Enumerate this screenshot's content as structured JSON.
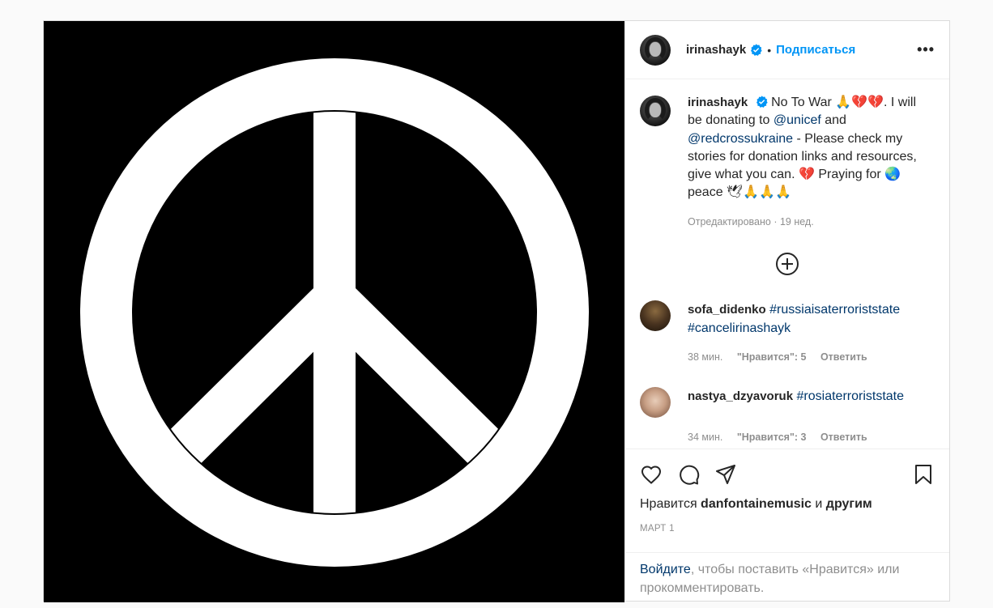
{
  "header": {
    "username": "irinashayk",
    "separator": "•",
    "follow_label": "Подписаться",
    "more_label": "•••"
  },
  "caption": {
    "username": "irinashayk",
    "text1": "No To War 🙏💔💔. I will be donating to ",
    "mention1": "@unicef",
    "text2": " and ",
    "mention2": "@redcrossukraine",
    "text3": " - Please check my stories for donation links and resources, give what you can. 💔 Praying for 🌏peace 🕊🙏🙏🙏",
    "meta": "Отредактировано · 19 нед."
  },
  "comments": [
    {
      "username": "sofa_didenko",
      "text": "#russiaisaterroriststate #cancelirinashayk",
      "time": "38 мин.",
      "likes": "\"Нравится\": 5",
      "reply": "Ответить"
    },
    {
      "username": "nastya_dzyavoruk",
      "text": "#rosiaterroriststate",
      "time": "34 мин.",
      "likes": "\"Нравится\": 3",
      "reply": "Ответить"
    }
  ],
  "likes": {
    "prefix": "Нравится ",
    "user": "danfontainemusic",
    "middle": " и ",
    "others": "другим"
  },
  "date": "МАРТ 1",
  "login": {
    "link": "Войдите",
    "rest": ", чтобы поставить «Нравится» или прокомментировать."
  },
  "colors": {
    "accent": "#0095f6",
    "link": "#00376b",
    "muted": "#8e8e8e",
    "text": "#262626"
  },
  "icons": [
    "verified-icon",
    "more-icon",
    "load-more-icon",
    "heart-icon",
    "comment-icon",
    "share-icon",
    "bookmark-icon"
  ]
}
